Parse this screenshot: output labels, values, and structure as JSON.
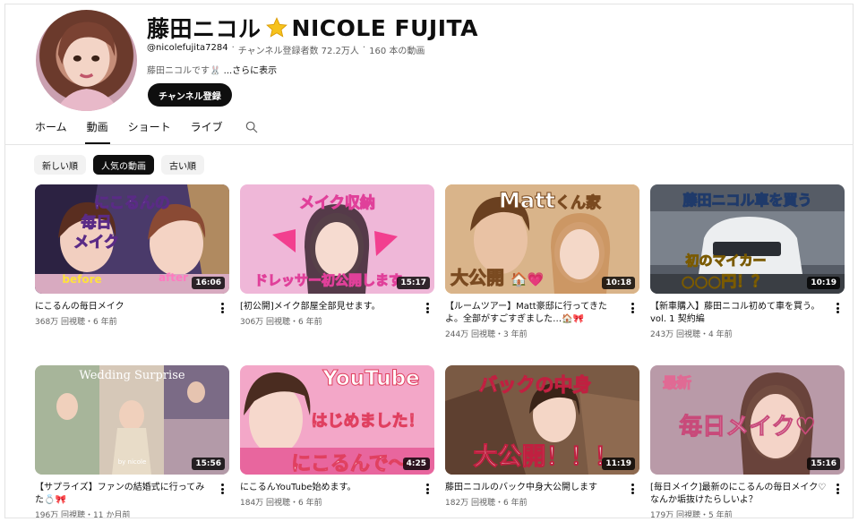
{
  "channel": {
    "name": "藤田ニコル",
    "name_latin": "NICOLE FUJITA",
    "handle": "@nicolefujita7284",
    "subscribers": "チャンネル登録者数 72.2万人",
    "video_count": "160 本の動画",
    "separator": "‧",
    "description": "藤田ニコルです🐰",
    "more": "...さらに表示",
    "subscribe_label": "チャンネル登録"
  },
  "tabs": [
    {
      "label": "ホーム",
      "active": false
    },
    {
      "label": "動画",
      "active": true
    },
    {
      "label": "ショート",
      "active": false
    },
    {
      "label": "ライブ",
      "active": false
    }
  ],
  "chips": [
    {
      "label": "新しい順",
      "active": false
    },
    {
      "label": "人気の動画",
      "active": true
    },
    {
      "label": "古い順",
      "active": false
    }
  ],
  "videos": [
    {
      "title": "にこるんの毎日メイク",
      "meta": "368万 回視聴・6 年前",
      "duration": "16:06",
      "overlay": [
        "にこるんの",
        "毎日",
        "メイク",
        "before",
        "after"
      ]
    },
    {
      "title": "[初公開]メイク部屋全部見せます。",
      "meta": "306万 回視聴・6 年前",
      "duration": "15:17",
      "overlay": [
        "メイク収納",
        "ドレッサー初公開しま",
        "す"
      ]
    },
    {
      "title": "【ルームツアー】Matt豪邸に行ってきたよ。全部がすごすぎました…🏠🎀",
      "meta": "244万 回視聴・3 年前",
      "duration": "10:18",
      "overlay": [
        "Matt",
        "くん家",
        "大公開"
      ]
    },
    {
      "title": "【新車購入】藤田ニコル初めて車を買う。vol. 1 契約編",
      "meta": "243万 回視聴・4 年前",
      "duration": "10:19",
      "overlay": [
        "藤田ニコル車を買う",
        "初のマイカー",
        "○○○円！？"
      ]
    },
    {
      "title": "【サプライズ】ファンの結婚式に行ってみた💍🎀",
      "meta": "196万 回視聴・11 か月前",
      "duration": "15:56",
      "overlay": [
        "Wedding Surprise",
        "by nicole"
      ]
    },
    {
      "title": "にこるんYouTube始めます。",
      "meta": "184万 回視聴・6 年前",
      "duration": "4:25",
      "overlay": [
        "YouTube",
        "はじめました！",
        "にこるんで〜"
      ]
    },
    {
      "title": "藤田ニコルのバック中身大公開します",
      "meta": "182万 回視聴・6 年前",
      "duration": "11:19",
      "overlay": [
        "バックの中身",
        "大公開！！！"
      ]
    },
    {
      "title": "[毎日メイク]最新のにこるんの毎日メイク♡なんか垢抜けたらしいよ？",
      "meta": "179万 回視聴・5 年前",
      "duration": "15:16",
      "overlay": [
        "最新",
        "毎日メイク♡"
      ]
    }
  ]
}
